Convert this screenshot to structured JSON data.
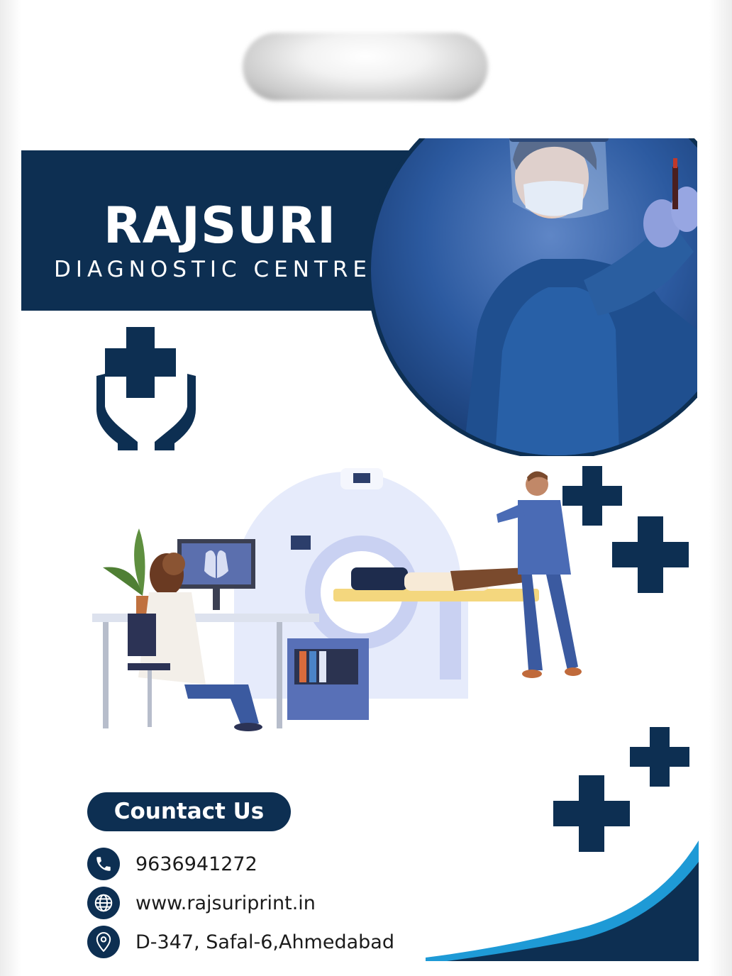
{
  "brand": {
    "name": "RAJSURI",
    "subtitle": "DIAGNOSTIC CENTRE"
  },
  "contact": {
    "heading": "Countact Us",
    "phone": "9636941272",
    "website": "www.rajsuriprint.in",
    "address": "D-347, Safal-6,Ahmedabad"
  },
  "icons": {
    "phone": "phone-icon",
    "web": "globe-icon",
    "location": "location-pin-icon",
    "care": "hands-holding-cross-icon"
  },
  "colors": {
    "navy": "#0d2f52",
    "accent_blue": "#1e9ad6",
    "photo_blue": "#2a5ea8"
  }
}
